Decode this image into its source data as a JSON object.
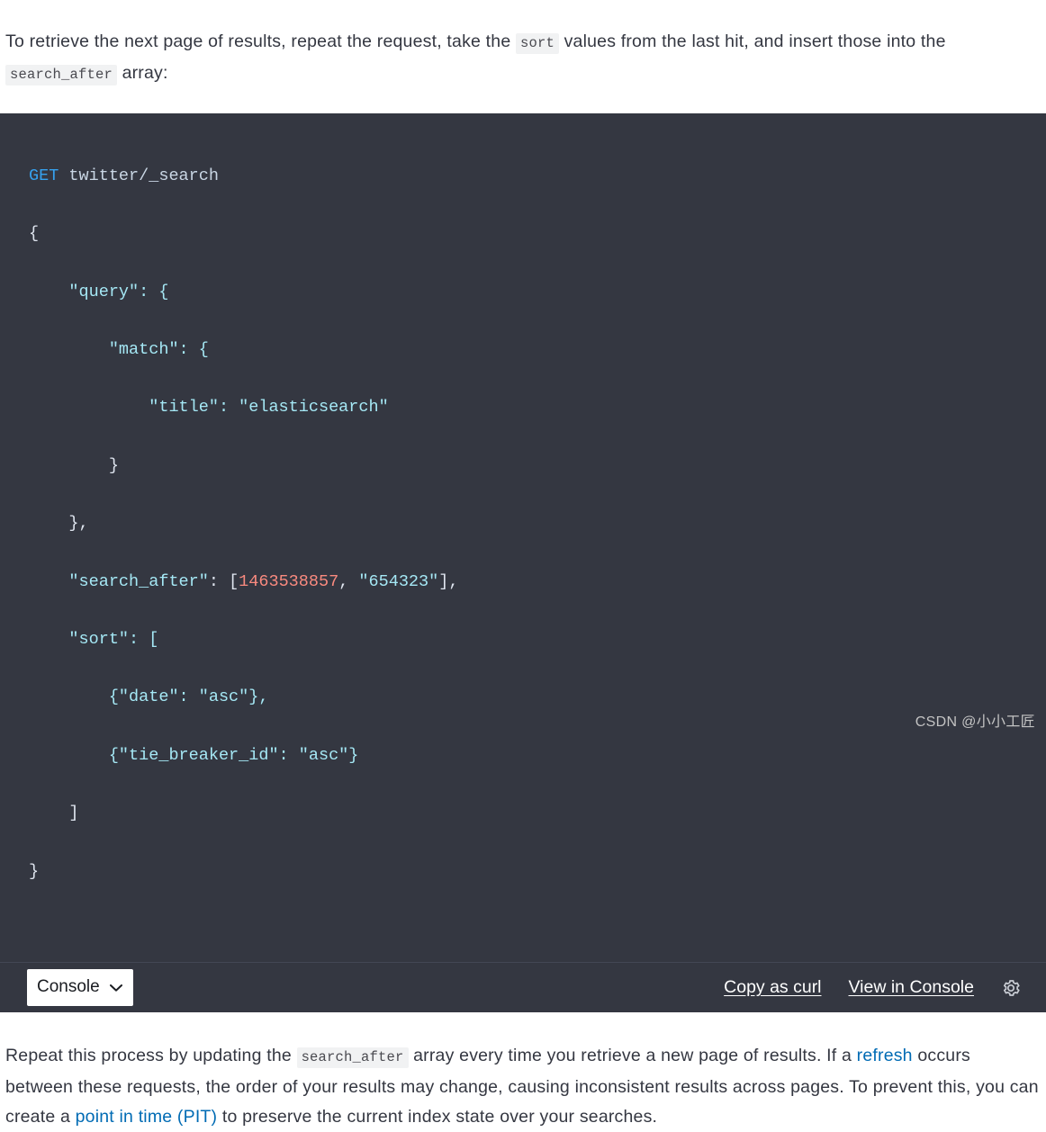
{
  "intro_paragraph": {
    "part1": "To retrieve the next page of results, repeat the request, take the ",
    "code1": "sort",
    "part2": " values from the last hit, and insert those into the ",
    "code2": "search_after",
    "part3": " array:"
  },
  "code_block": {
    "language_label": "Console",
    "request_method": "GET",
    "request_path": "twitter/_search",
    "lines": [
      {
        "indent": 0,
        "text": "{"
      },
      {
        "indent": 1,
        "text": "\"query\": {"
      },
      {
        "indent": 2,
        "text": "\"match\": {"
      },
      {
        "indent": 3,
        "text": "\"title\": \"elasticsearch\""
      },
      {
        "indent": 2,
        "text": "}"
      },
      {
        "indent": 1,
        "text": "},"
      },
      {
        "indent": 1,
        "text": "\"search_after\": [1463538857, \"654323\"],"
      },
      {
        "indent": 1,
        "text": "\"sort\": ["
      },
      {
        "indent": 2,
        "text": "{\"date\": \"asc\"},"
      },
      {
        "indent": 2,
        "text": "{\"tie_breaker_id\": \"asc\"}"
      },
      {
        "indent": 1,
        "text": "]"
      },
      {
        "indent": 0,
        "text": "}"
      }
    ],
    "toolbar": {
      "select_value": "Console",
      "select_options": [
        "Console"
      ],
      "copy_as_curl_label": "Copy as curl",
      "view_in_console_label": "View in Console",
      "settings_icon": "gear-icon"
    },
    "colors": {
      "background": "#343741",
      "method": "#36a2ef",
      "url": "#c9d6e4",
      "string": "#a5e8f5",
      "number": "#f98a7f",
      "punctuation": "#dfe5ef",
      "toolbar_divider": "#434754"
    }
  },
  "outro_paragraph": {
    "part1": "Repeat this process by updating the ",
    "code1": "search_after",
    "part2": " array every time you retrieve a new page of results. If a ",
    "link1": "refresh",
    "part3": " occurs between these requests, the order of your results may change, causing inconsistent results across pages. To prevent this, you can create a ",
    "link2": "point in time (PIT)",
    "part4": " to preserve the current index state over your searches."
  },
  "watermark": {
    "text": "CSDN @小小工匠"
  },
  "theme": {
    "link_color": "#006bb4",
    "text_color": "#343741",
    "inline_code_bg": "#f1f2f3"
  }
}
